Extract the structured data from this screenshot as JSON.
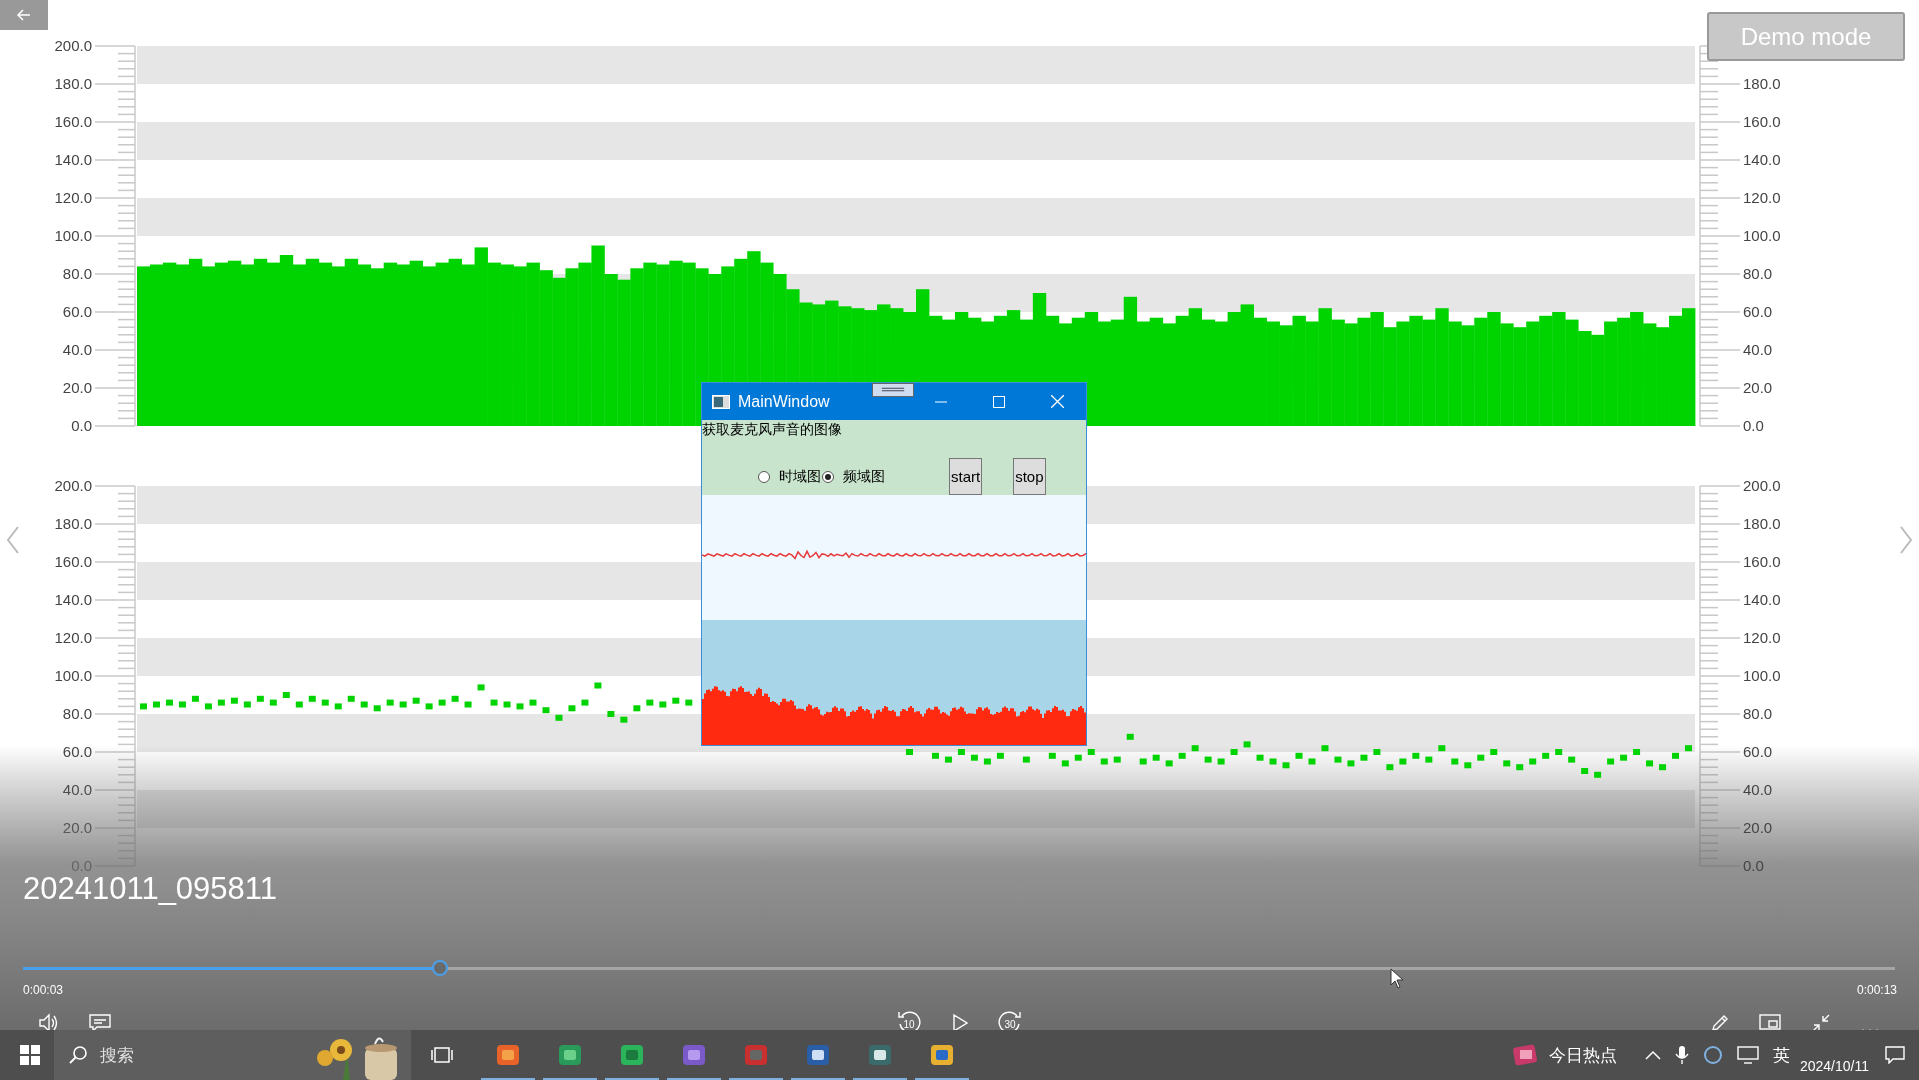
{
  "player": {
    "demo_button": {
      "label": "Demo mode",
      "disabled": true
    },
    "title": "20241011_095811",
    "progress": {
      "level": 0.223
    },
    "elapsed": "0:00:03",
    "duration": "0:00:13",
    "skip_back": "10",
    "skip_forward": "30"
  },
  "charts": [
    {
      "right_axis_ticks": [
        "180.0",
        "160.0",
        "140.0",
        "120.0",
        "100.0",
        "80.0",
        "60.0",
        "40.0",
        "20.0",
        "0.0"
      ],
      "chart_data": {
        "type": "bar",
        "ylim": [
          0,
          200
        ],
        "yticks": [
          {
            "value": 0,
            "label": "0.0"
          },
          {
            "value": 20,
            "label": "20.0"
          },
          {
            "value": 40,
            "label": "40.0"
          },
          {
            "value": 60,
            "label": "60.0"
          },
          {
            "value": 80,
            "label": "80.0"
          },
          {
            "value": 100,
            "label": "100.0"
          },
          {
            "value": 120,
            "label": "120.0"
          },
          {
            "value": 140,
            "label": "140.0"
          },
          {
            "value": 160,
            "label": "160.0"
          },
          {
            "value": 180,
            "label": "180.0"
          },
          {
            "value": 200,
            "label": "200.0"
          }
        ],
        "series": [
          {
            "color": "#00d400",
            "values": [
              84,
              85,
              86,
              85,
              88,
              84,
              86,
              87,
              85,
              88,
              86,
              90,
              85,
              88,
              86,
              84,
              88,
              85,
              83,
              86,
              85,
              87,
              84,
              86,
              88,
              85,
              94,
              86,
              85,
              84,
              86,
              82,
              78,
              83,
              86,
              95,
              80,
              77,
              83,
              86,
              85,
              87,
              86,
              83,
              80,
              84,
              88,
              92,
              86,
              80,
              72,
              65,
              64,
              66,
              63,
              62,
              61,
              64,
              62,
              60,
              72,
              58,
              56,
              60,
              57,
              55,
              58,
              61,
              56,
              70,
              58,
              54,
              57,
              60,
              55,
              56,
              68,
              55,
              57,
              54,
              58,
              62,
              56,
              55,
              60,
              64,
              57,
              55,
              53,
              58,
              55,
              62,
              56,
              54,
              57,
              60,
              52,
              55,
              58,
              56,
              62,
              55,
              53,
              57,
              60,
              54,
              52,
              55,
              58,
              60,
              56,
              50,
              48,
              55,
              57,
              60,
              54,
              52,
              58,
              62
            ]
          }
        ]
      }
    },
    {
      "right_axis_ticks": [
        "200.0",
        "180.0",
        "160.0",
        "140.0",
        "120.0",
        "100.0",
        "80.0",
        "60.0",
        "40.0",
        "20.0",
        "0.0"
      ],
      "chart_data": {
        "type": "scatter",
        "ylim": [
          0,
          200
        ],
        "yticks": [
          {
            "value": 0,
            "label": "0.0"
          },
          {
            "value": 20,
            "label": "20.0"
          },
          {
            "value": 40,
            "label": "40.0"
          },
          {
            "value": 60,
            "label": "60.0"
          },
          {
            "value": 80,
            "label": "80.0"
          },
          {
            "value": 100,
            "label": "100.0"
          },
          {
            "value": 120,
            "label": "120.0"
          },
          {
            "value": 140,
            "label": "140.0"
          },
          {
            "value": 160,
            "label": "160.0"
          },
          {
            "value": 180,
            "label": "180.0"
          },
          {
            "value": 200,
            "label": "200.0"
          }
        ],
        "series": [
          {
            "color": "#00d400",
            "values": [
              84,
              85,
              86,
              85,
              88,
              84,
              86,
              87,
              85,
              88,
              86,
              90,
              85,
              88,
              86,
              84,
              88,
              85,
              83,
              86,
              85,
              87,
              84,
              86,
              88,
              85,
              94,
              86,
              85,
              84,
              86,
              82,
              78,
              83,
              86,
              95,
              80,
              77,
              83,
              86,
              85,
              87,
              86,
              null,
              null,
              null,
              null,
              null,
              null,
              null,
              null,
              null,
              null,
              null,
              null,
              null,
              null,
              null,
              null,
              60,
              null,
              58,
              56,
              60,
              57,
              55,
              58,
              null,
              56,
              null,
              58,
              54,
              57,
              60,
              55,
              56,
              68,
              55,
              57,
              54,
              58,
              62,
              56,
              55,
              60,
              64,
              57,
              55,
              53,
              58,
              55,
              62,
              56,
              54,
              57,
              60,
              52,
              55,
              58,
              56,
              62,
              55,
              53,
              57,
              60,
              54,
              52,
              55,
              58,
              60,
              56,
              50,
              48,
              55,
              57,
              60,
              54,
              52,
              58,
              62
            ]
          }
        ]
      }
    }
  ],
  "mini_window": {
    "title": "MainWindow",
    "heading": "获取麦克风声音的图像",
    "options": [
      {
        "label": "时域图",
        "selected": false
      },
      {
        "label": "频域图",
        "selected": true
      }
    ],
    "buttons": [
      "start",
      "stop"
    ]
  },
  "taskbar": {
    "search": {
      "placeholder": "搜索"
    },
    "news": "今日热点",
    "ime": "英",
    "date": "2024/10/11"
  }
}
